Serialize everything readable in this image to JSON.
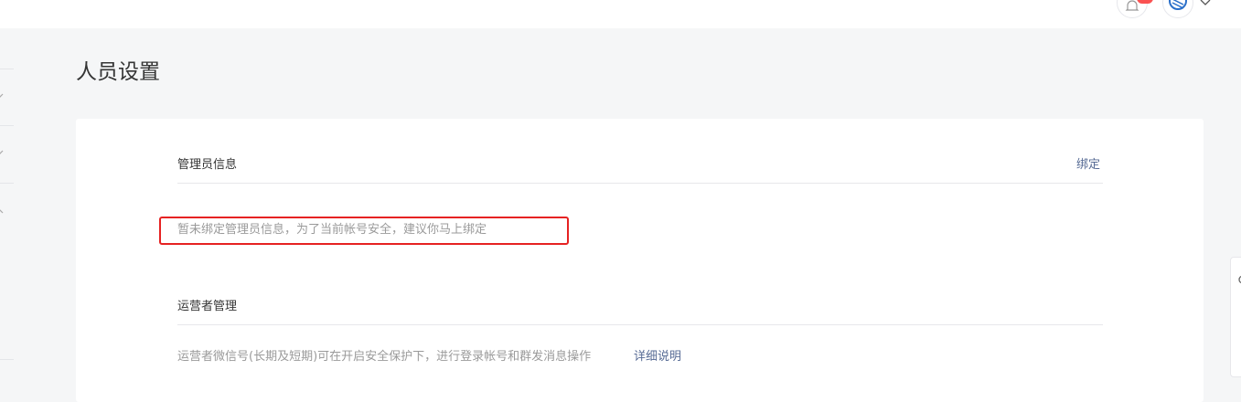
{
  "page": {
    "title": "人员设置"
  },
  "admin_section": {
    "title": "管理员信息",
    "bind_link": "绑定",
    "notice": "暂未绑定管理员信息，为了当前帐号安全，建议你马上绑定"
  },
  "operator_section": {
    "title": "运营者管理",
    "description": "运营者微信号(长期及短期)可在开启安全保护下，进行登录帐号和群发消息操作",
    "detail_link": "详细说明"
  },
  "colors": {
    "link": "#576b95",
    "highlight_box": "#e62222",
    "badge": "#fa5151"
  }
}
